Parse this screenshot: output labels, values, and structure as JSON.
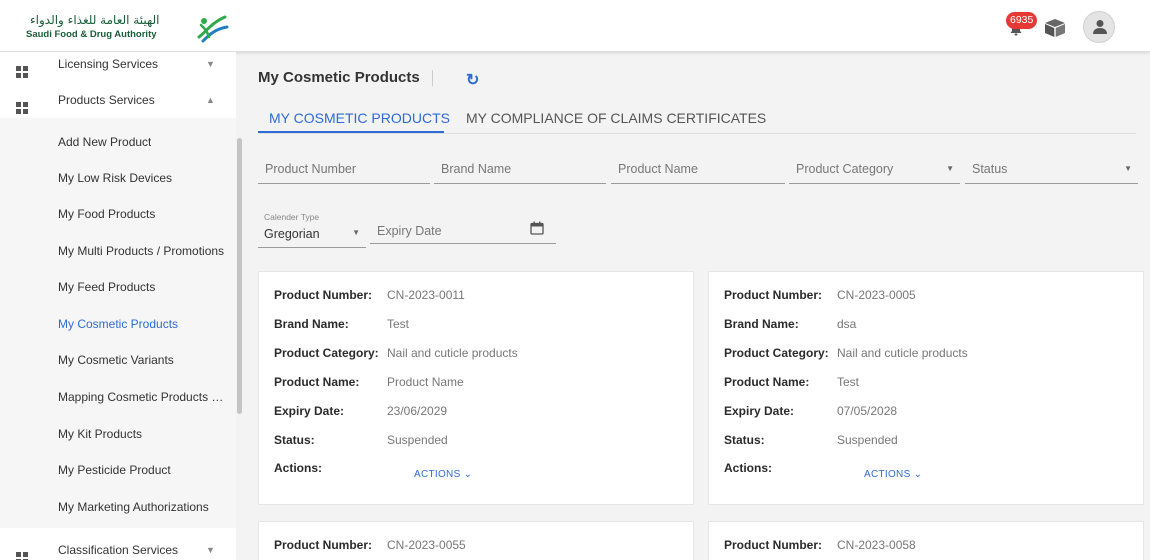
{
  "brand": {
    "logo_text_ar": "الهيئة العامة للغذاء والدواء",
    "logo_text_en": "Saudi Food & Drug Authority"
  },
  "topbar": {
    "notification_count": "6935",
    "icons": [
      "bell-icon",
      "box-icon",
      "user-icon"
    ]
  },
  "sidebar": {
    "sections": [
      {
        "label": "Licensing Services",
        "expanded": false
      },
      {
        "label": "Products Services",
        "expanded": true
      },
      {
        "label": "Classification Services",
        "expanded": false
      }
    ],
    "sub_items": [
      {
        "label": "Add New Product",
        "active": false
      },
      {
        "label": "My Low Risk Devices",
        "active": false
      },
      {
        "label": "My Food Products",
        "active": false
      },
      {
        "label": "My Multi Products / Promotions",
        "active": false
      },
      {
        "label": "My Feed Products",
        "active": false
      },
      {
        "label": "My Cosmetic Products",
        "active": true
      },
      {
        "label": "My Cosmetic Variants",
        "active": false
      },
      {
        "label": "Mapping Cosmetic Products Nu...",
        "active": false
      },
      {
        "label": "My Kit Products",
        "active": false
      },
      {
        "label": "My Pesticide Product",
        "active": false
      },
      {
        "label": "My Marketing Authorizations",
        "active": false
      }
    ]
  },
  "main": {
    "page_title": "My Cosmetic Products",
    "tabs": [
      {
        "label": "MY COSMETIC PRODUCTS",
        "active": true
      },
      {
        "label": "MY COMPLIANCE OF CLAIMS CERTIFICATES",
        "active": false
      }
    ],
    "filters": {
      "product_number": "Product Number",
      "brand_name": "Brand Name",
      "product_name": "Product Name",
      "product_category": "Product Category",
      "status": "Status",
      "calendar_type_label": "Calender Type",
      "calendar_type_value": "Gregorian",
      "expiry_date": "Expiry Date"
    },
    "field_labels": {
      "product_number": "Product Number:",
      "brand_name": "Brand Name:",
      "product_category": "Product Category:",
      "product_name": "Product Name:",
      "expiry_date": "Expiry Date:",
      "status": "Status:",
      "actions": "Actions:"
    },
    "actions_label": "ACTIONS ⌄",
    "cards": [
      {
        "product_number": "CN-2023-0011",
        "brand_name": "Test",
        "product_category": "Nail and cuticle products",
        "product_name": "Product Name",
        "expiry_date": "23/06/2029",
        "status": "Suspended"
      },
      {
        "product_number": "CN-2023-0005",
        "brand_name": "dsa",
        "product_category": "Nail and cuticle products",
        "product_name": "Test",
        "expiry_date": "07/05/2028",
        "status": "Suspended"
      },
      {
        "product_number": "CN-2023-0055"
      },
      {
        "product_number": "CN-2023-0058"
      }
    ]
  },
  "colors": {
    "accent": "#2e6bd4",
    "badge": "#e53935",
    "brand_green": "#1a5d3a"
  }
}
